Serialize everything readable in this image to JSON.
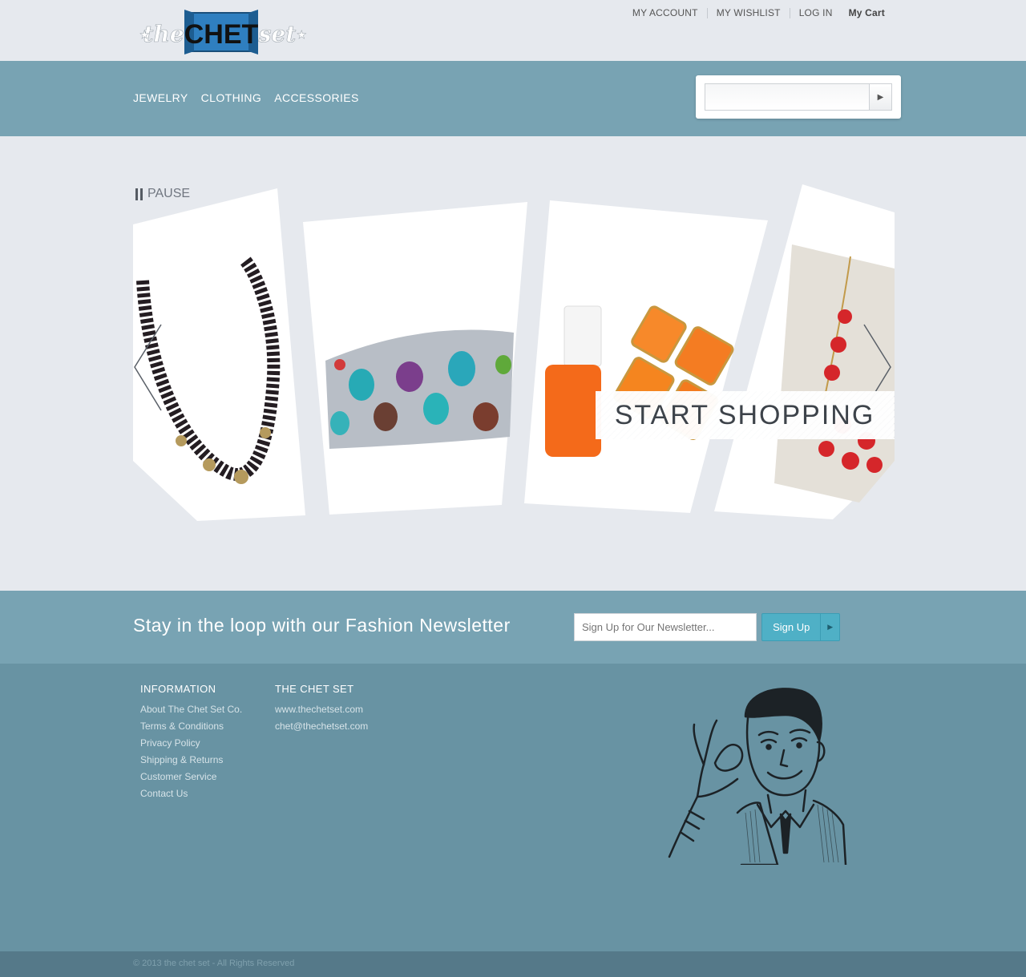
{
  "header": {
    "logo": {
      "left": "the",
      "main": "CHET",
      "right": "set"
    },
    "links": [
      "MY ACCOUNT",
      "MY WISHLIST",
      "LOG IN"
    ],
    "cart": "My Cart"
  },
  "nav": {
    "items": [
      "JEWELRY",
      "CLOTHING",
      "ACCESSORIES"
    ]
  },
  "search": {
    "placeholder": "",
    "button_icon": "play-arrow-icon"
  },
  "slider": {
    "pause_label": "PAUSE",
    "cta": "START SHOPPING",
    "slides": [
      "black-bead-necklace",
      "jeweled-bracelet",
      "orange-nail-polish-and-bracelet",
      "red-statement-necklace"
    ]
  },
  "newsletter": {
    "title": "Stay in the loop with our Fashion Newsletter",
    "placeholder": "Sign Up for Our Newsletter...",
    "button": "Sign Up"
  },
  "footer": {
    "information": {
      "heading": "INFORMATION",
      "links": [
        "About The Chet Set Co.",
        "Terms & Conditions",
        "Privacy Policy",
        "Shipping & Returns",
        "Customer Service",
        "Contact Us"
      ]
    },
    "chetset": {
      "heading": "THE CHET SET",
      "links": [
        "www.thechetset.com",
        "chet@thechetset.com"
      ]
    },
    "copyright": "© 2013 the chet set - All Rights Reserved"
  },
  "colors": {
    "teal": "#78a3b3",
    "footer": "#6893a3",
    "accent": "#4fb0c6",
    "background": "#e6e9ee"
  }
}
